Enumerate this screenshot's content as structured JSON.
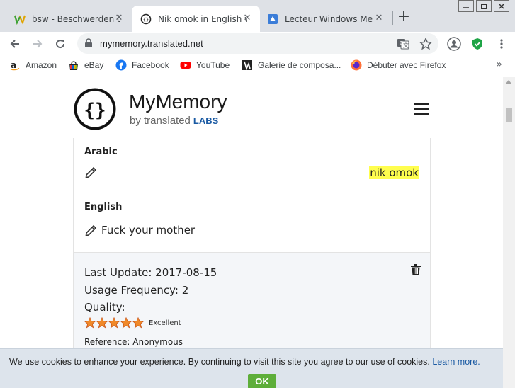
{
  "browser": {
    "tabs": [
      {
        "title": "bsw - Beschwerden über",
        "active": false,
        "icon": "bsw-favicon"
      },
      {
        "title": "Nik omok in English w",
        "active": true,
        "icon": "mymemory-favicon"
      },
      {
        "title": "Lecteur Windows Med",
        "active": false,
        "icon": "media-player-favicon"
      }
    ],
    "new_tab": "+",
    "url": "mymemory.translated.net",
    "bookmarks": [
      {
        "label": "Amazon",
        "icon": "amazon-icon"
      },
      {
        "label": "eBay",
        "icon": "ebay-icon"
      },
      {
        "label": "Facebook",
        "icon": "facebook-icon"
      },
      {
        "label": "YouTube",
        "icon": "youtube-icon"
      },
      {
        "label": "Galerie de composa...",
        "icon": "gallery-icon"
      },
      {
        "label": "Débuter avec Firefox",
        "icon": "firefox-icon"
      }
    ],
    "more": "»"
  },
  "site": {
    "brand": "MyMemory",
    "brand_sub": "by translated",
    "brand_labs": "LABS"
  },
  "source": {
    "language": "Arabic",
    "text": "nik omok"
  },
  "target": {
    "language": "English",
    "text": "Fuck your mother"
  },
  "meta": {
    "last_update": "Last Update: 2017-08-15",
    "usage": "Usage Frequency: 2",
    "quality_label": "Quality:",
    "quality_rating": 5,
    "quality_max": 5,
    "quality_word": "Excellent",
    "reference": "Reference: Anonymous"
  },
  "cookie": {
    "text": "We use cookies to enhance your experience. By continuing to visit this site you agree to our use of cookies.",
    "link": "Learn more.",
    "ok": "OK"
  },
  "colors": {
    "highlight": "#fffe4e",
    "brand_blue": "#1a5aa3",
    "ok_green": "#5eae3a",
    "star_orange": "#f0892a"
  }
}
